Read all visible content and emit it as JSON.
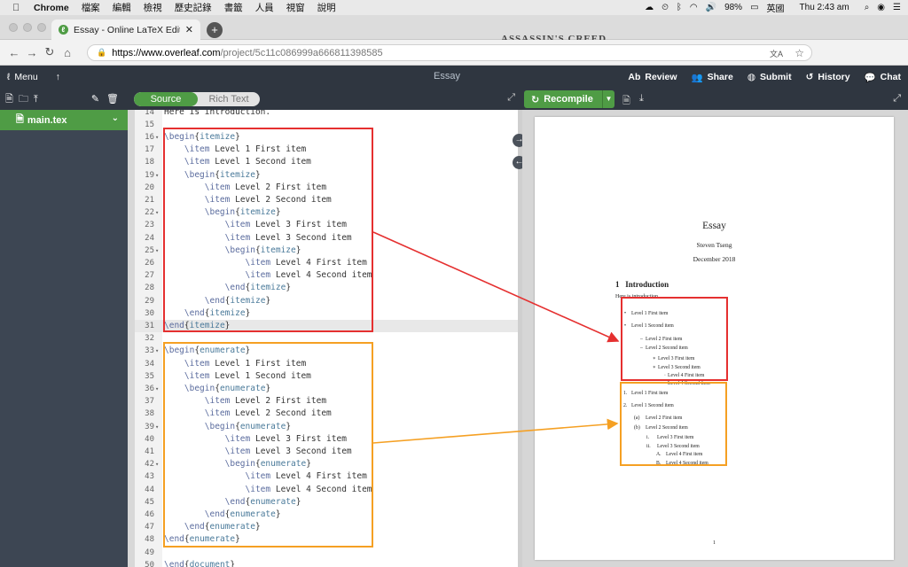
{
  "menubar": {
    "app": "Chrome",
    "menus": [
      "檔案",
      "編輯",
      "檢視",
      "歷史記錄",
      "書籤",
      "人員",
      "視窗",
      "說明"
    ],
    "battery": "98%",
    "input_method": "英國",
    "clock": "Thu 2:43 am"
  },
  "browser": {
    "tab_title": "Essay - Online LaTeX Editor Ov",
    "new_tab": "+",
    "brand": "ASSASSIN'S CREED",
    "url_domain": "https://www.overleaf.com",
    "url_path": "/project/5c11c086999a666811398585"
  },
  "toolbar": {
    "menu": "Menu",
    "project": "Essay",
    "actions": [
      "Review",
      "Share",
      "Submit",
      "History",
      "Chat"
    ]
  },
  "sidebar": {
    "file": "main.tex"
  },
  "editor": {
    "mode_source": "Source",
    "mode_rich": "Rich Text",
    "lines": [
      {
        "n": "14",
        "t": "Here is introduction."
      },
      {
        "n": "15",
        "t": ""
      },
      {
        "n": "16",
        "t": "\\begin{itemize}",
        "f": true
      },
      {
        "n": "17",
        "t": "    \\item Level 1 First item"
      },
      {
        "n": "18",
        "t": "    \\item Level 1 Second item"
      },
      {
        "n": "19",
        "t": "    \\begin{itemize}",
        "f": true
      },
      {
        "n": "20",
        "t": "        \\item Level 2 First item"
      },
      {
        "n": "21",
        "t": "        \\item Level 2 Second item"
      },
      {
        "n": "22",
        "t": "        \\begin{itemize}",
        "f": true
      },
      {
        "n": "23",
        "t": "            \\item Level 3 First item"
      },
      {
        "n": "24",
        "t": "            \\item Level 3 Second item"
      },
      {
        "n": "25",
        "t": "            \\begin{itemize}",
        "f": true
      },
      {
        "n": "26",
        "t": "                \\item Level 4 First item"
      },
      {
        "n": "27",
        "t": "                \\item Level 4 Second item"
      },
      {
        "n": "28",
        "t": "            \\end{itemize}"
      },
      {
        "n": "29",
        "t": "        \\end{itemize}"
      },
      {
        "n": "30",
        "t": "    \\end{itemize}"
      },
      {
        "n": "31",
        "t": "\\end{itemize}",
        "hl": true
      },
      {
        "n": "32",
        "t": ""
      },
      {
        "n": "33",
        "t": "\\begin{enumerate}",
        "f": true
      },
      {
        "n": "34",
        "t": "    \\item Level 1 First item"
      },
      {
        "n": "35",
        "t": "    \\item Level 1 Second item"
      },
      {
        "n": "36",
        "t": "    \\begin{enumerate}",
        "f": true
      },
      {
        "n": "37",
        "t": "        \\item Level 2 First item"
      },
      {
        "n": "38",
        "t": "        \\item Level 2 Second item"
      },
      {
        "n": "39",
        "t": "        \\begin{enumerate}",
        "f": true
      },
      {
        "n": "40",
        "t": "            \\item Level 3 First item"
      },
      {
        "n": "41",
        "t": "            \\item Level 3 Second item"
      },
      {
        "n": "42",
        "t": "            \\begin{enumerate}",
        "f": true
      },
      {
        "n": "43",
        "t": "                \\item Level 4 First item"
      },
      {
        "n": "44",
        "t": "                \\item Level 4 Second item"
      },
      {
        "n": "45",
        "t": "            \\end{enumerate}"
      },
      {
        "n": "46",
        "t": "        \\end{enumerate}"
      },
      {
        "n": "47",
        "t": "    \\end{enumerate}"
      },
      {
        "n": "48",
        "t": "\\end{enumerate}"
      },
      {
        "n": "49",
        "t": ""
      },
      {
        "n": "50",
        "t": "\\end{document}"
      }
    ]
  },
  "pdf": {
    "recompile": "Recompile",
    "title": "Essay",
    "author": "Steven Tseng",
    "date": "December 2018",
    "section_num": "1",
    "section": "Introduction",
    "intro": "Here is introduction.",
    "page_number": "1",
    "itemize": [
      {
        "m": "•",
        "t": "Level 1 First item",
        "lvl": 1
      },
      {
        "m": "•",
        "t": "Level 1 Second item",
        "lvl": 1
      },
      {
        "m": "–",
        "t": "Level 2 First item",
        "lvl": 2
      },
      {
        "m": "–",
        "t": "Level 2 Second item",
        "lvl": 2
      },
      {
        "m": "∗",
        "t": "Level 3 First item",
        "lvl": 3
      },
      {
        "m": "∗",
        "t": "Level 3 Second item",
        "lvl": 3
      },
      {
        "m": "·",
        "t": "Level 4 First item",
        "lvl": 4
      },
      {
        "m": "·",
        "t": "Level 4 Second item",
        "lvl": 4
      }
    ],
    "enumerate": [
      {
        "m": "1.",
        "t": "Level 1 First item",
        "lvl": 1
      },
      {
        "m": "2.",
        "t": "Level 1 Second item",
        "lvl": 1
      },
      {
        "m": "(a)",
        "t": "Level 2 First item",
        "lvl": 2
      },
      {
        "m": "(b)",
        "t": "Level 2 Second item",
        "lvl": 2
      },
      {
        "m": "i.",
        "t": "Level 3 First item",
        "lvl": 3
      },
      {
        "m": "ii.",
        "t": "Level 3 Second item",
        "lvl": 3
      },
      {
        "m": "A.",
        "t": "Level 4 First item",
        "lvl": 4
      },
      {
        "m": "B.",
        "t": "Level 4 Second item",
        "lvl": 4
      }
    ]
  },
  "colors": {
    "accent_green": "#4f9c45",
    "annotation_red": "#e53030",
    "annotation_orange": "#f5a023"
  }
}
